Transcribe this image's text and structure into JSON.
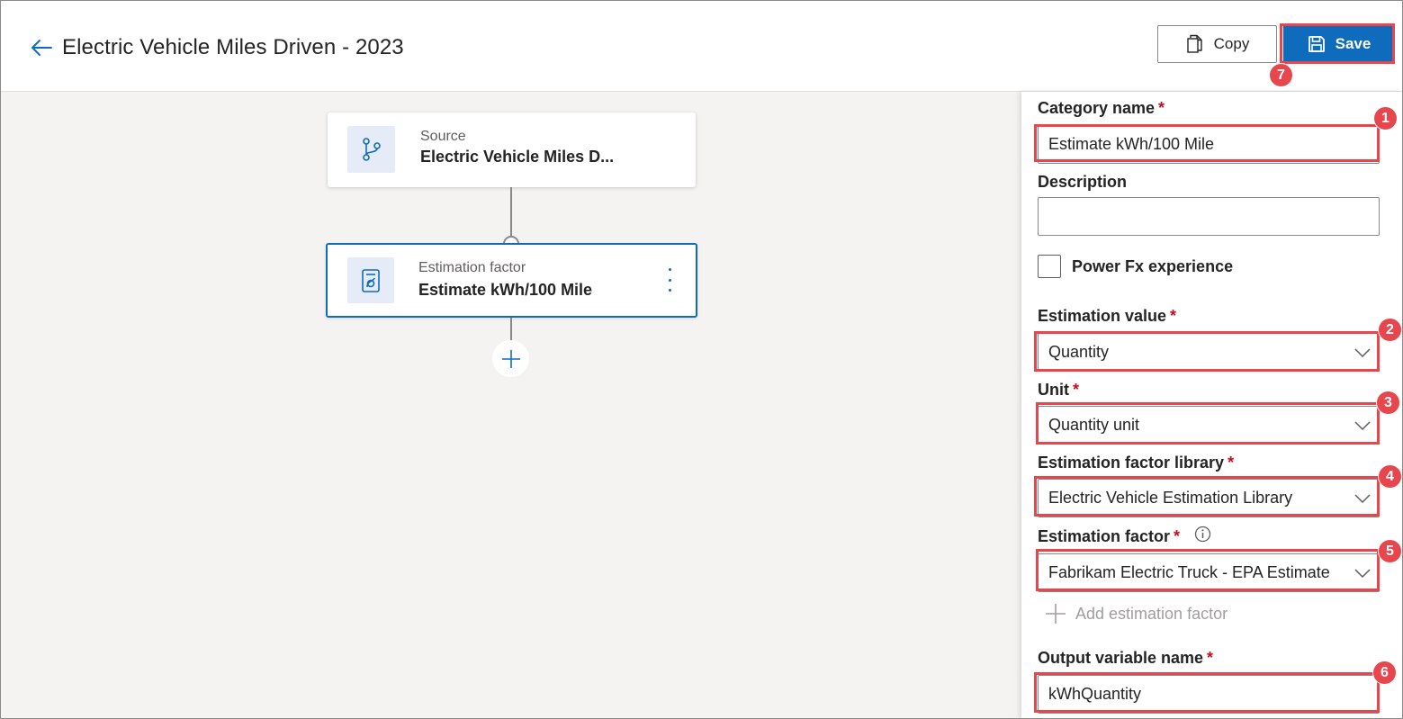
{
  "header": {
    "title": "Electric Vehicle Miles Driven - 2023",
    "copy_label": "Copy",
    "save_label": "Save",
    "save_badge": "7"
  },
  "canvas": {
    "source_node": {
      "kind": "Source",
      "name": "Electric Vehicle Miles D..."
    },
    "estimation_node": {
      "kind": "Estimation factor",
      "name": "Estimate kWh/100 Mile"
    }
  },
  "panel": {
    "category_name": {
      "label": "Category name",
      "value": "Estimate kWh/100 Mile",
      "badge": "1"
    },
    "description": {
      "label": "Description",
      "value": ""
    },
    "power_fx": {
      "label": "Power Fx experience",
      "checked": false
    },
    "estimation_value": {
      "label": "Estimation value",
      "value": "Quantity",
      "badge": "2"
    },
    "unit": {
      "label": "Unit",
      "value": "Quantity unit",
      "badge": "3"
    },
    "library": {
      "label": "Estimation factor library",
      "value": "Electric Vehicle Estimation Library",
      "badge": "4"
    },
    "factor": {
      "label": "Estimation factor",
      "value": "Fabrikam Electric Truck - EPA Estimate",
      "badge": "5"
    },
    "add_factor_label": "Add estimation factor",
    "output": {
      "label": "Output variable name",
      "value": "kWhQuantity",
      "badge": "6"
    },
    "required_mark": "*"
  },
  "colors": {
    "accent": "#0f6cbd",
    "highlight": "#e8464d",
    "required": "#c50f1f",
    "canvas_bg": "#f5f3f1"
  }
}
